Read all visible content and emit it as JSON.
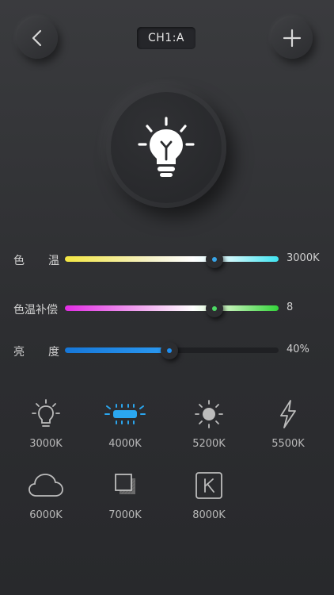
{
  "header": {
    "channel": "CH1:A",
    "back_icon": "chevron-left-icon",
    "add_icon": "plus-icon"
  },
  "hero": {
    "icon": "lightbulb-icon"
  },
  "sliders": [
    {
      "label_a": "色",
      "label_b": "温",
      "value_text": "3000K",
      "level": 0.7,
      "thumb_color": "#38a4e8"
    },
    {
      "label": "色温补偿",
      "value_text": "8",
      "level": 0.7,
      "thumb_color": "#4cd964"
    },
    {
      "label_a": "亮",
      "label_b": "度",
      "value_text": "40%",
      "level": 0.49,
      "thumb_color": "#1e8ef0"
    }
  ],
  "presets": [
    {
      "label": "3000K",
      "icon": "bulb-outline-icon"
    },
    {
      "label": "4000K",
      "icon": "fluorescent-tube-icon",
      "active": true
    },
    {
      "label": "5200K",
      "icon": "sun-icon"
    },
    {
      "label": "5500K",
      "icon": "lightning-icon"
    },
    {
      "label": "6000K",
      "icon": "cloud-icon"
    },
    {
      "label": "7000K",
      "icon": "shade-icon"
    },
    {
      "label": "8000K",
      "icon": "k-box-icon"
    }
  ],
  "colors": {
    "active": "#2ba7f0",
    "inactive": "#bcbcbc"
  }
}
